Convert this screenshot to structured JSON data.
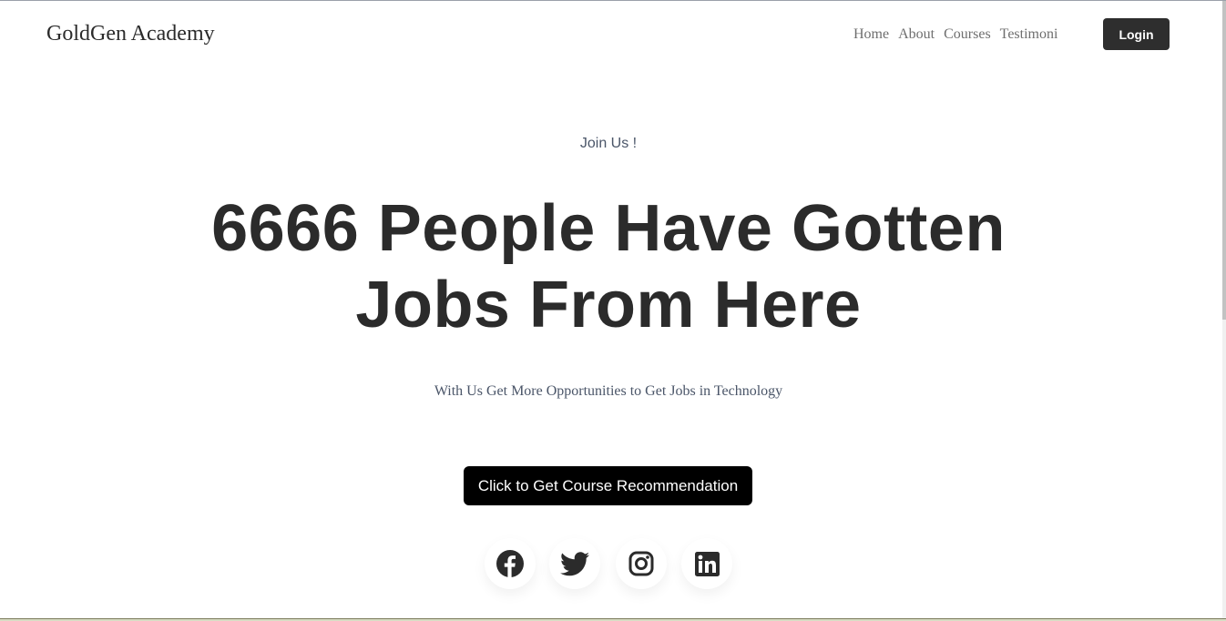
{
  "header": {
    "brand": "GoldGen Academy",
    "nav": [
      {
        "label": "Home"
      },
      {
        "label": "About"
      },
      {
        "label": "Courses"
      },
      {
        "label": "Testimoni"
      }
    ],
    "login_label": "Login"
  },
  "hero": {
    "eyebrow": "Join Us !",
    "headline_line1": "6666 People Have Gotten",
    "headline_line2": "Jobs From Here",
    "subline": "With Us Get More Opportunities to Get Jobs in Technology",
    "cta_label": "Click to Get Course Recommendation"
  },
  "social": [
    {
      "icon": "facebook-icon"
    },
    {
      "icon": "twitter-icon"
    },
    {
      "icon": "instagram-icon"
    },
    {
      "icon": "linkedin-icon"
    }
  ],
  "colors": {
    "text_dark": "#2b2b2b",
    "text_muted": "#4a5568",
    "button_dark": "#2e2e2e",
    "cta_bg": "#000000",
    "background": "#ffffff"
  }
}
